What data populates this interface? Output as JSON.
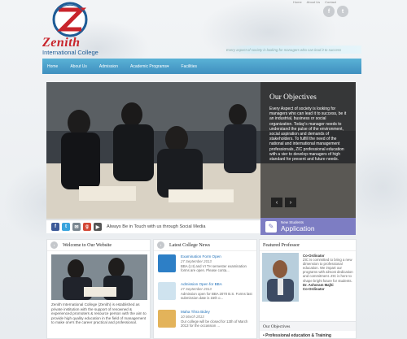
{
  "colors": {
    "nav": "#4a9fcc",
    "brand_red": "#c8242b",
    "admission": "#7d7dc3",
    "link": "#1e6fb8"
  },
  "topbar": {
    "links": [
      "Home",
      "About Us",
      "Contact"
    ]
  },
  "social_top": {
    "facebook": "f",
    "twitter": "t"
  },
  "brand": {
    "name": "Zenith",
    "sub": "International College",
    "seal": "Education Experience Growth"
  },
  "tagline": "Every aspect of society is looking for managers who can lead it to success",
  "nav": {
    "items": [
      "Home",
      "About Us",
      "Admission",
      "Academic Programs▾",
      "Facilities"
    ]
  },
  "objectives": {
    "title": "Our Objectives",
    "text": "Every Aspect of society is looking for managers who can lead it to success, be it an industrial, business or social organization. Today's manager needs to understand the pulse of the environment, social aspiration and demands of stakeholders. To fulfill the need of the national and international management professionals, ZIC professional education with a vier to develop managers of high standard for present and future needs.",
    "prev": "‹",
    "next": "›"
  },
  "admission": {
    "small": "New Students",
    "big": "Application"
  },
  "social_bar": {
    "label": "Always Be in Touch with us through Social Media",
    "icons": [
      "f",
      "t",
      "✉",
      "g",
      "▶"
    ]
  },
  "welcome": {
    "title": "Welcome to Our Website",
    "text": "Zenith International College (Zenith) is established as private institution with the support of renowned & experienced promoters & resource person with the aim to provide high quality education in the field of management to make one's the career practical and professional."
  },
  "news": {
    "title": "Latest College News",
    "items": [
      {
        "title": "Examination Form Open",
        "date": "27 September 2013",
        "desc": "BBA (I,II) and VI TH semester examination forms are open. Please conta..."
      },
      {
        "title": "Admission Open for BBA",
        "date": "27 September 2013",
        "desc": "Admission open for BBA 2070 B.S. Forms last submission date is 15th o..."
      },
      {
        "title": "Maha Tihra Bidey",
        "date": "10 March 2013",
        "desc": "Our college will be closed for 13th of March 2013 for the occassion ..."
      }
    ]
  },
  "featured": {
    "title": "Featured Professor",
    "role": "Co-Ordinator",
    "text": "ZIC is committed to bring a new dimension to professional education. We impart our programs with almost dedication and commitment. ZIC is here to shape bright future for students.",
    "name": "Dr. Ashoram Majhi",
    "name_role": "Co-Ordinator"
  },
  "objectives_box": {
    "title": "Our Objectives",
    "item": "• Professional education & Training"
  }
}
